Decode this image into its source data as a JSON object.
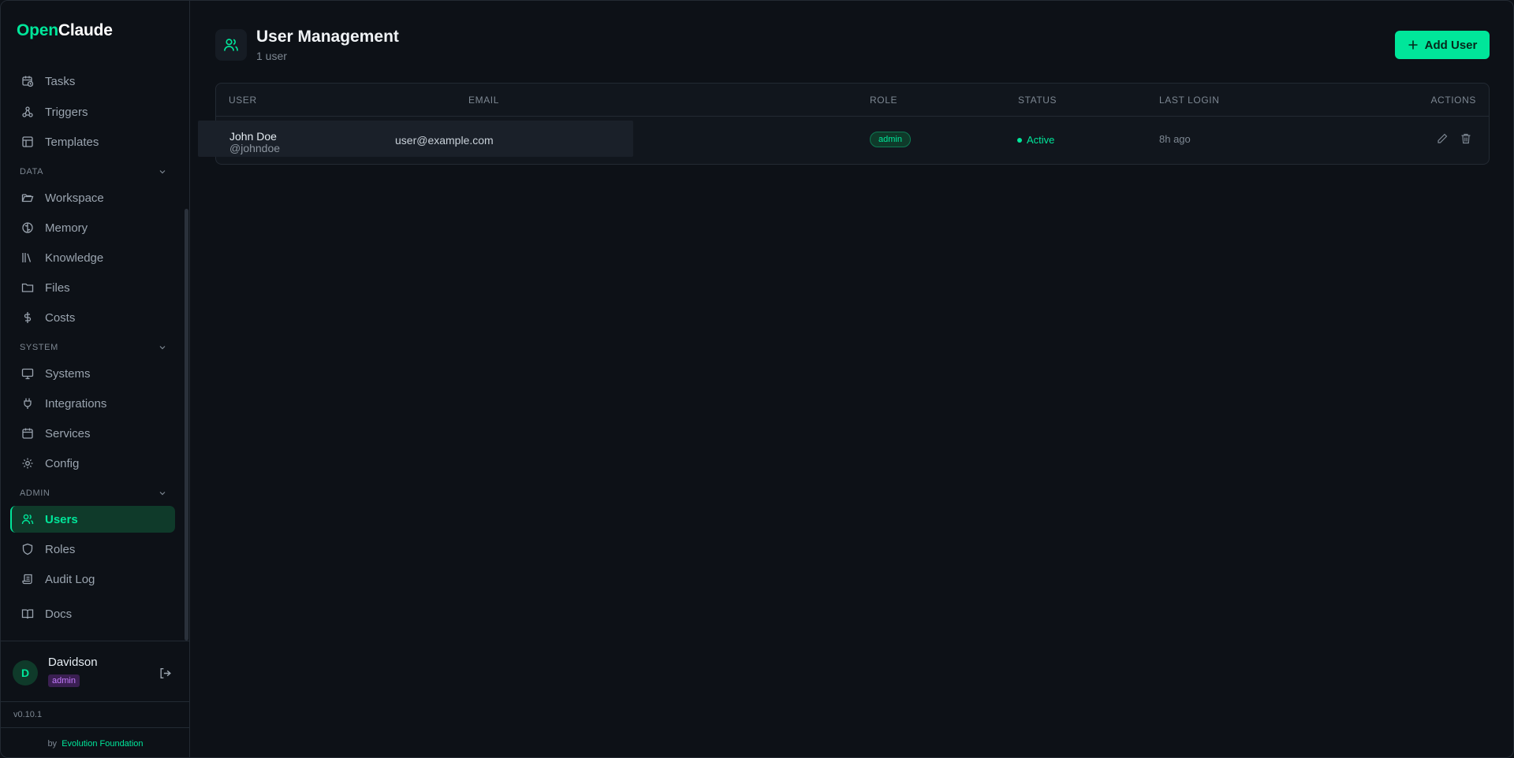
{
  "app": {
    "logo_part1": "Open",
    "logo_part2": "Claude",
    "version": "v0.10.1",
    "by_prefix": "by",
    "by_org": "Evolution Foundation"
  },
  "sidebar": {
    "top_items": [
      {
        "label": "Tasks",
        "icon": "calendar-clock-icon"
      },
      {
        "label": "Triggers",
        "icon": "webhook-icon"
      },
      {
        "label": "Templates",
        "icon": "layout-icon"
      }
    ],
    "sections": [
      {
        "title": "DATA",
        "items": [
          {
            "label": "Workspace",
            "icon": "folder-open-icon"
          },
          {
            "label": "Memory",
            "icon": "brain-icon"
          },
          {
            "label": "Knowledge",
            "icon": "library-icon"
          },
          {
            "label": "Files",
            "icon": "folder-icon"
          },
          {
            "label": "Costs",
            "icon": "dollar-icon"
          }
        ]
      },
      {
        "title": "SYSTEM",
        "items": [
          {
            "label": "Systems",
            "icon": "monitor-icon"
          },
          {
            "label": "Integrations",
            "icon": "plug-icon"
          },
          {
            "label": "Services",
            "icon": "calendar-icon"
          },
          {
            "label": "Config",
            "icon": "gear-icon"
          }
        ]
      },
      {
        "title": "ADMIN",
        "items": [
          {
            "label": "Users",
            "icon": "users-icon",
            "active": true
          },
          {
            "label": "Roles",
            "icon": "shield-icon"
          },
          {
            "label": "Audit Log",
            "icon": "scroll-icon"
          }
        ]
      }
    ],
    "docs": {
      "label": "Docs",
      "icon": "book-icon"
    },
    "current_user": {
      "initial": "D",
      "name": "Davidson",
      "role": "admin"
    }
  },
  "page": {
    "title": "User Management",
    "subtitle": "1 user",
    "add_button": "Add User"
  },
  "table": {
    "columns": [
      "USER",
      "EMAIL",
      "ROLE",
      "STATUS",
      "LAST LOGIN",
      "ACTIONS"
    ],
    "rows": [
      {
        "name": "John Doe",
        "handle": "@johndoe",
        "email": "user@example.com",
        "role": "admin",
        "status": "Active",
        "last_login": "8h ago"
      }
    ]
  },
  "colors": {
    "accent": "#00e69a",
    "background": "#0d1117",
    "admin_badge": "#c47bff"
  }
}
